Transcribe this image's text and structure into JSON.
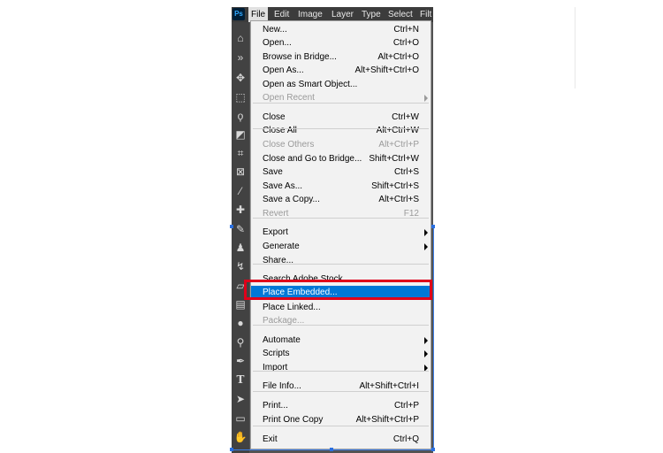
{
  "app": {
    "logo": "Ps"
  },
  "menubar": {
    "items": [
      "File",
      "Edit",
      "Image",
      "Layer",
      "Type",
      "Select",
      "Filt"
    ]
  },
  "toolbar": {
    "icons": [
      "home-icon",
      "expand-icon",
      "move-icon",
      "marquee-icon",
      "lasso-icon",
      "object-select-icon",
      "crop-icon",
      "frame-icon",
      "eyedropper-icon",
      "healing-brush-icon",
      "brush-icon",
      "clone-stamp-icon",
      "history-brush-icon",
      "eraser-icon",
      "gradient-icon",
      "blur-icon",
      "dodge-icon",
      "pen-icon",
      "type-icon",
      "path-select-icon",
      "rectangle-icon",
      "hand-icon"
    ]
  },
  "file_menu": {
    "items": [
      {
        "label": "New...",
        "shortcut": "Ctrl+N"
      },
      {
        "label": "Open...",
        "shortcut": "Ctrl+O"
      },
      {
        "label": "Browse in Bridge...",
        "shortcut": "Alt+Ctrl+O"
      },
      {
        "label": "Open As...",
        "shortcut": "Alt+Shift+Ctrl+O"
      },
      {
        "label": "Open as Smart Object...",
        "shortcut": ""
      },
      {
        "label": "Open Recent",
        "shortcut": "",
        "disabled": true,
        "submenu": true
      },
      {
        "label": "Close",
        "shortcut": "Ctrl+W"
      },
      {
        "label": "Close All",
        "shortcut": "Alt+Ctrl+W"
      },
      {
        "label": "Close Others",
        "shortcut": "Alt+Ctrl+P",
        "disabled": true
      },
      {
        "label": "Close and Go to Bridge...",
        "shortcut": "Shift+Ctrl+W"
      },
      {
        "label": "Save",
        "shortcut": "Ctrl+S"
      },
      {
        "label": "Save As...",
        "shortcut": "Shift+Ctrl+S"
      },
      {
        "label": "Save a Copy...",
        "shortcut": "Alt+Ctrl+S"
      },
      {
        "label": "Revert",
        "shortcut": "F12",
        "disabled": true
      },
      {
        "label": "Export",
        "shortcut": "",
        "submenu": true
      },
      {
        "label": "Generate",
        "shortcut": "",
        "submenu": true
      },
      {
        "label": "Share...",
        "shortcut": ""
      },
      {
        "label": "Search Adobe Stock...",
        "shortcut": ""
      },
      {
        "label": "Place Embedded...",
        "shortcut": "",
        "highlighted": true
      },
      {
        "label": "Place Linked...",
        "shortcut": ""
      },
      {
        "label": "Package...",
        "shortcut": "",
        "disabled": true
      },
      {
        "label": "Automate",
        "shortcut": "",
        "submenu": true
      },
      {
        "label": "Scripts",
        "shortcut": "",
        "submenu": true
      },
      {
        "label": "Import",
        "shortcut": "",
        "submenu": true
      },
      {
        "label": "File Info...",
        "shortcut": "Alt+Shift+Ctrl+I"
      },
      {
        "label": "Print...",
        "shortcut": "Ctrl+P"
      },
      {
        "label": "Print One Copy",
        "shortcut": "Alt+Shift+Ctrl+P"
      },
      {
        "label": "Exit",
        "shortcut": "Ctrl+Q"
      }
    ]
  },
  "colors": {
    "highlight": "#0078d7",
    "annotation": "#e0001a",
    "menu_bg": "#f2f2f2",
    "app_bg": "#535353"
  }
}
